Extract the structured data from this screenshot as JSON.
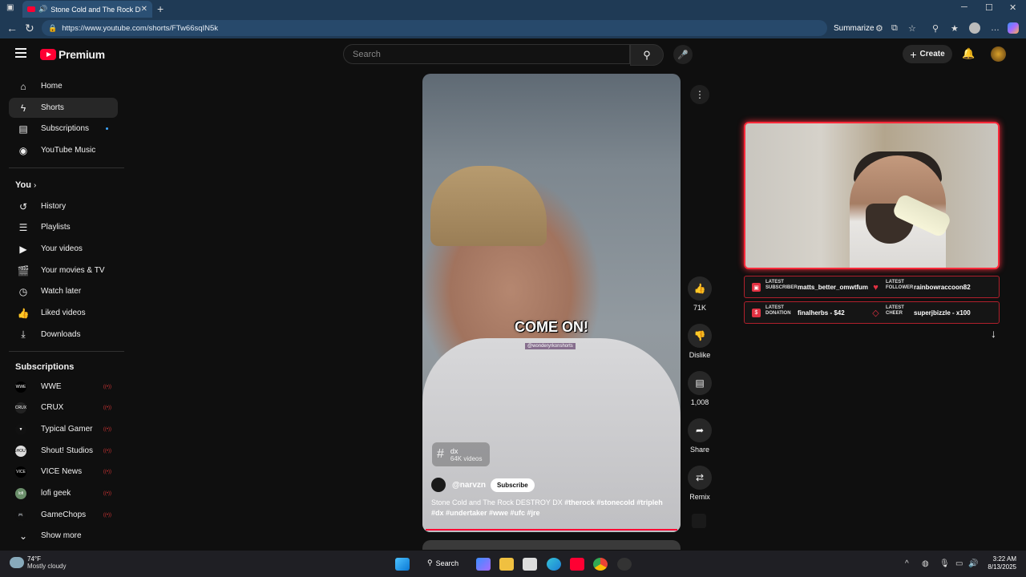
{
  "browser": {
    "tab_title": "Stone Cold and The Rock DESTROY",
    "tab_close": "✕",
    "new_tab": "+",
    "url": "https://www.youtube.com/shorts/FTw66sqIN5k",
    "summarize_label": "Summarize",
    "window_controls": [
      "─",
      "☐",
      "✕"
    ]
  },
  "header": {
    "logo_text": "Premium",
    "search_placeholder": "Search",
    "create_label": "Create"
  },
  "sidebar": {
    "main_items": [
      {
        "label": "Home",
        "icon": "home-icon"
      },
      {
        "label": "Shorts",
        "icon": "shorts-icon",
        "active": true
      },
      {
        "label": "Subscriptions",
        "icon": "subscriptions-icon",
        "new_dot": true
      },
      {
        "label": "YouTube Music",
        "icon": "music-icon"
      }
    ],
    "you_heading": "You",
    "you_items": [
      {
        "label": "History",
        "icon": "history-icon"
      },
      {
        "label": "Playlists",
        "icon": "playlists-icon"
      },
      {
        "label": "Your videos",
        "icon": "your-videos-icon"
      },
      {
        "label": "Your movies & TV",
        "icon": "movies-icon"
      },
      {
        "label": "Watch later",
        "icon": "watch-later-icon"
      },
      {
        "label": "Liked videos",
        "icon": "like-icon"
      },
      {
        "label": "Downloads",
        "icon": "download-icon"
      }
    ],
    "subscriptions_heading": "Subscriptions",
    "subscriptions": [
      {
        "label": "WWE",
        "avatar_text": "WWE",
        "avatar_color": "#000000"
      },
      {
        "label": "CRUX",
        "avatar_text": "CRUX",
        "avatar_color": "#222222"
      },
      {
        "label": "Typical Gamer",
        "avatar_text": "▼",
        "avatar_color": "#111111"
      },
      {
        "label": "Shout! Studios",
        "avatar_text": "SHOUT",
        "avatar_color": "#dddddd"
      },
      {
        "label": "VICE News",
        "avatar_text": "VICE",
        "avatar_color": "#000000"
      },
      {
        "label": "lofi geek",
        "avatar_text": "lofi",
        "avatar_color": "#6b8f6b"
      },
      {
        "label": "GameChops",
        "avatar_text": "🎮",
        "avatar_color": "#0f0f0f"
      }
    ],
    "show_more": "Show more"
  },
  "video": {
    "caption": "COME ON!",
    "watermark": "@wonderyrkonshorts",
    "tag": "dx",
    "tag_count": "64K videos",
    "channel": "@narvzn",
    "subscribe_label": "Subscribe",
    "title_plain": "Stone Cold and The Rock DESTROY DX ",
    "title_tags_1": "#therock #stonecold #tripleh",
    "title_tags_2": "#dx #undertaker #wwe #ufc #jre"
  },
  "actions": {
    "like_count": "71K",
    "dislike_label": "Dislike",
    "comments_count": "1,008",
    "share_label": "Share",
    "remix_label": "Remix"
  },
  "stream_overlay": {
    "latest_subscriber_label": [
      "LATEST",
      "SUBSCRIBER"
    ],
    "latest_subscriber": "matts_better_omwtfum",
    "latest_follower_label": [
      "LATEST",
      "FOLLOWER"
    ],
    "latest_follower": "rainbowraccoon82",
    "latest_donation_label": [
      "LATEST",
      "DONATION"
    ],
    "latest_donation": "finalherbs - $42",
    "latest_cheer_label": [
      "LATEST",
      "CHEER"
    ],
    "latest_cheer": "superjbizzle - x100",
    "accent_color": "#ff2a3a"
  },
  "taskbar": {
    "temperature": "74°F",
    "weather": "Mostly cloudy",
    "search_label": "Search",
    "time": "3:22 AM",
    "date": "8/13/2025"
  }
}
